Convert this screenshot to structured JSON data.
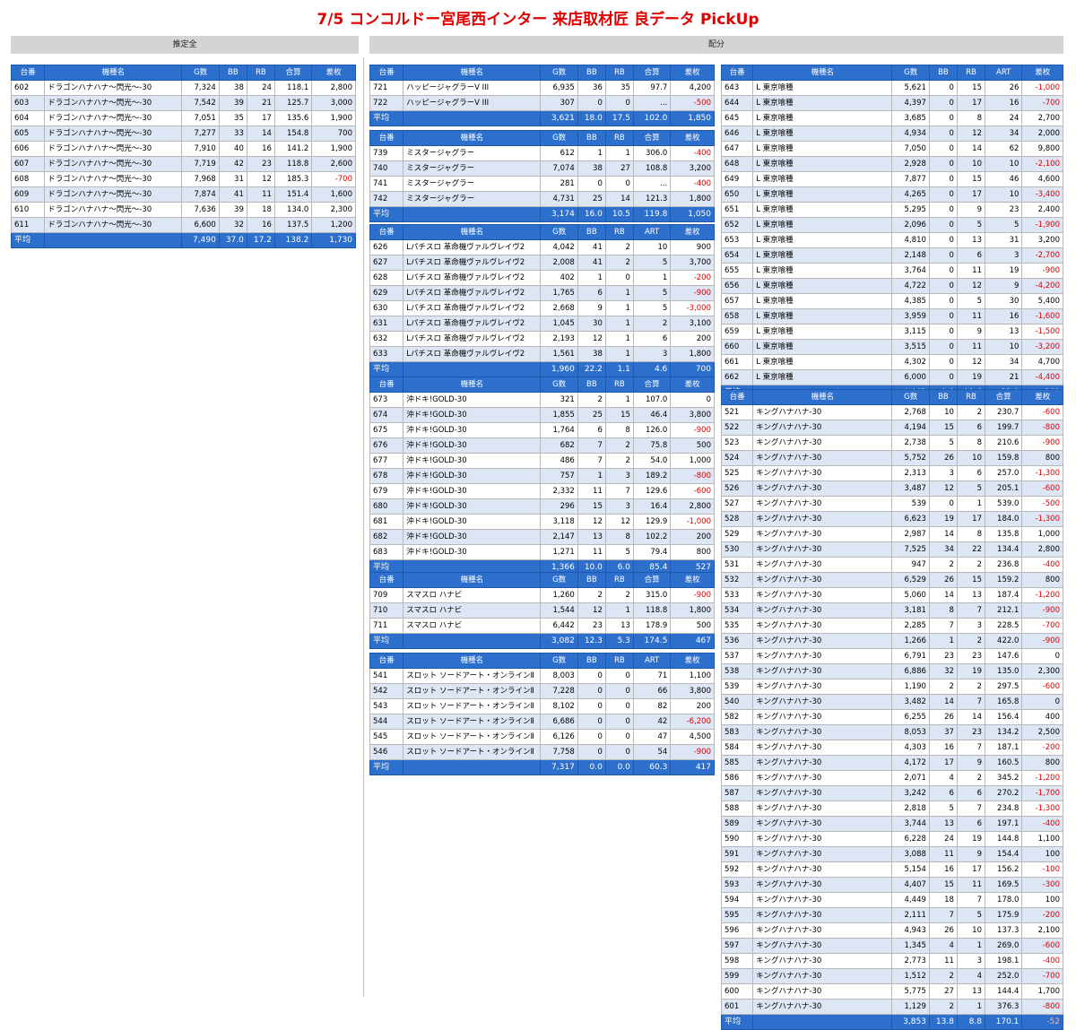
{
  "title": "7/5 コンコルドー宮尾西インター 来店取材匠 良データ PickUp",
  "sections": {
    "left": "推定全",
    "right": "配分"
  },
  "tables": [
    {
      "id": "dragon",
      "columns": [
        "台番",
        "機種名",
        "G数",
        "BB",
        "RB",
        "合算",
        "差枚"
      ],
      "rows": [
        [
          "602",
          "ドラゴンハナハナ〜閃光〜-30",
          "7,324",
          "38",
          "24",
          "118.1",
          "2,800"
        ],
        [
          "603",
          "ドラゴンハナハナ〜閃光〜-30",
          "7,542",
          "39",
          "21",
          "125.7",
          "3,000"
        ],
        [
          "604",
          "ドラゴンハナハナ〜閃光〜-30",
          "7,051",
          "35",
          "17",
          "135.6",
          "1,900"
        ],
        [
          "605",
          "ドラゴンハナハナ〜閃光〜-30",
          "7,277",
          "33",
          "14",
          "154.8",
          "700"
        ],
        [
          "606",
          "ドラゴンハナハナ〜閃光〜-30",
          "7,910",
          "40",
          "16",
          "141.2",
          "1,900"
        ],
        [
          "607",
          "ドラゴンハナハナ〜閃光〜-30",
          "7,719",
          "42",
          "23",
          "118.8",
          "2,600"
        ],
        [
          "608",
          "ドラゴンハナハナ〜閃光〜-30",
          "7,968",
          "31",
          "12",
          "185.3",
          "-700"
        ],
        [
          "609",
          "ドラゴンハナハナ〜閃光〜-30",
          "7,874",
          "41",
          "11",
          "151.4",
          "1,600"
        ],
        [
          "610",
          "ドラゴンハナハナ〜閃光〜-30",
          "7,636",
          "39",
          "18",
          "134.0",
          "2,300"
        ],
        [
          "611",
          "ドラゴンハナハナ〜閃光〜-30",
          "6,600",
          "32",
          "16",
          "137.5",
          "1,200"
        ]
      ],
      "avg": [
        "平均",
        "",
        "7,490",
        "37.0",
        "17.2",
        "138.2",
        "1,730"
      ]
    },
    {
      "id": "happy",
      "columns": [
        "台番",
        "機種名",
        "G数",
        "BB",
        "RB",
        "合算",
        "差枚"
      ],
      "rows": [
        [
          "721",
          "ハッピージャグラーV III",
          "6,935",
          "36",
          "35",
          "97.7",
          "4,200"
        ],
        [
          "722",
          "ハッピージャグラーV III",
          "307",
          "0",
          "0",
          "...",
          "-500"
        ]
      ],
      "avg": [
        "平均",
        "",
        "3,621",
        "18.0",
        "17.5",
        "102.0",
        "1,850"
      ]
    },
    {
      "id": "mister",
      "columns": [
        "台番",
        "機種名",
        "G数",
        "BB",
        "RB",
        "合算",
        "差枚"
      ],
      "rows": [
        [
          "739",
          "ミスタージャグラー",
          "612",
          "1",
          "1",
          "306.0",
          "-400"
        ],
        [
          "740",
          "ミスタージャグラー",
          "7,074",
          "38",
          "27",
          "108.8",
          "3,200"
        ],
        [
          "741",
          "ミスタージャグラー",
          "281",
          "0",
          "0",
          "...",
          "-400"
        ],
        [
          "742",
          "ミスタージャグラー",
          "4,731",
          "25",
          "14",
          "121.3",
          "1,800"
        ]
      ],
      "avg": [
        "平均",
        "",
        "3,174",
        "16.0",
        "10.5",
        "119.8",
        "1,050"
      ]
    },
    {
      "id": "valvrave",
      "columns": [
        "台番",
        "機種名",
        "G数",
        "BB",
        "RB",
        "ART",
        "差枚"
      ],
      "rows": [
        [
          "626",
          "Lパチスロ 革命機ヴァルヴレイヴ2",
          "4,042",
          "41",
          "2",
          "10",
          "900"
        ],
        [
          "627",
          "Lパチスロ 革命機ヴァルヴレイヴ2",
          "2,008",
          "41",
          "2",
          "5",
          "3,700"
        ],
        [
          "628",
          "Lパチスロ 革命機ヴァルヴレイヴ2",
          "402",
          "1",
          "0",
          "1",
          "-200"
        ],
        [
          "629",
          "Lパチスロ 革命機ヴァルヴレイヴ2",
          "1,765",
          "6",
          "1",
          "5",
          "-900"
        ],
        [
          "630",
          "Lパチスロ 革命機ヴァルヴレイヴ2",
          "2,668",
          "9",
          "1",
          "5",
          "-3,000"
        ],
        [
          "631",
          "Lパチスロ 革命機ヴァルヴレイヴ2",
          "1,045",
          "30",
          "1",
          "2",
          "3,100"
        ],
        [
          "632",
          "Lパチスロ 革命機ヴァルヴレイヴ2",
          "2,193",
          "12",
          "1",
          "6",
          "200"
        ],
        [
          "633",
          "Lパチスロ 革命機ヴァルヴレイヴ2",
          "1,561",
          "38",
          "1",
          "3",
          "1,800"
        ]
      ],
      "avg": [
        "平均",
        "",
        "1,960",
        "22.2",
        "1.1",
        "4.6",
        "700"
      ]
    },
    {
      "id": "okidoki",
      "columns": [
        "台番",
        "機種名",
        "G数",
        "BB",
        "RB",
        "合算",
        "差枚"
      ],
      "rows": [
        [
          "673",
          "沖ドキ!GOLD-30",
          "321",
          "2",
          "1",
          "107.0",
          "0"
        ],
        [
          "674",
          "沖ドキ!GOLD-30",
          "1,855",
          "25",
          "15",
          "46.4",
          "3,800"
        ],
        [
          "675",
          "沖ドキ!GOLD-30",
          "1,764",
          "6",
          "8",
          "126.0",
          "-900"
        ],
        [
          "676",
          "沖ドキ!GOLD-30",
          "682",
          "7",
          "2",
          "75.8",
          "500"
        ],
        [
          "677",
          "沖ドキ!GOLD-30",
          "486",
          "7",
          "2",
          "54.0",
          "1,000"
        ],
        [
          "678",
          "沖ドキ!GOLD-30",
          "757",
          "1",
          "3",
          "189.2",
          "-800"
        ],
        [
          "679",
          "沖ドキ!GOLD-30",
          "2,332",
          "11",
          "7",
          "129.6",
          "-600"
        ],
        [
          "680",
          "沖ドキ!GOLD-30",
          "296",
          "15",
          "3",
          "16.4",
          "2,800"
        ],
        [
          "681",
          "沖ドキ!GOLD-30",
          "3,118",
          "12",
          "12",
          "129.9",
          "-1,000"
        ],
        [
          "682",
          "沖ドキ!GOLD-30",
          "2,147",
          "13",
          "8",
          "102.2",
          "200"
        ],
        [
          "683",
          "沖ドキ!GOLD-30",
          "1,271",
          "11",
          "5",
          "79.4",
          "800"
        ]
      ],
      "avg": [
        "平均",
        "",
        "1,366",
        "10.0",
        "6.0",
        "85.4",
        "527"
      ]
    },
    {
      "id": "hanabi",
      "columns": [
        "台番",
        "機種名",
        "G数",
        "BB",
        "RB",
        "合算",
        "差枚"
      ],
      "rows": [
        [
          "709",
          "スマスロ ハナビ",
          "1,260",
          "2",
          "2",
          "315.0",
          "-900"
        ],
        [
          "710",
          "スマスロ ハナビ",
          "1,544",
          "12",
          "1",
          "118.8",
          "1,800"
        ],
        [
          "711",
          "スマスロ ハナビ",
          "6,442",
          "23",
          "13",
          "178.9",
          "500"
        ]
      ],
      "avg": [
        "平均",
        "",
        "3,082",
        "12.3",
        "5.3",
        "174.5",
        "467"
      ]
    },
    {
      "id": "sao",
      "columns": [
        "台番",
        "機種名",
        "G数",
        "BB",
        "RB",
        "ART",
        "差枚"
      ],
      "rows": [
        [
          "541",
          "スロット ソードアート・オンラインⅡ",
          "8,003",
          "0",
          "0",
          "71",
          "1,100"
        ],
        [
          "542",
          "スロット ソードアート・オンラインⅡ",
          "7,228",
          "0",
          "0",
          "66",
          "3,800"
        ],
        [
          "543",
          "スロット ソードアート・オンラインⅡ",
          "8,102",
          "0",
          "0",
          "82",
          "200"
        ],
        [
          "544",
          "スロット ソードアート・オンラインⅡ",
          "6,686",
          "0",
          "0",
          "42",
          "-6,200"
        ],
        [
          "545",
          "スロット ソードアート・オンラインⅡ",
          "6,126",
          "0",
          "0",
          "47",
          "4,500"
        ],
        [
          "546",
          "スロット ソードアート・オンラインⅡ",
          "7,758",
          "0",
          "0",
          "54",
          "-900"
        ]
      ],
      "avg": [
        "平均",
        "",
        "7,317",
        "0.0",
        "0.0",
        "60.3",
        "417"
      ]
    },
    {
      "id": "ghoul",
      "columns": [
        "台番",
        "機種名",
        "G数",
        "BB",
        "RB",
        "ART",
        "差枚"
      ],
      "rows": [
        [
          "643",
          "L 東京喰種",
          "5,621",
          "0",
          "15",
          "26",
          "-1,000"
        ],
        [
          "644",
          "L 東京喰種",
          "4,397",
          "0",
          "17",
          "16",
          "-700"
        ],
        [
          "645",
          "L 東京喰種",
          "3,685",
          "0",
          "8",
          "24",
          "2,700"
        ],
        [
          "646",
          "L 東京喰種",
          "4,934",
          "0",
          "12",
          "34",
          "2,000"
        ],
        [
          "647",
          "L 東京喰種",
          "7,050",
          "0",
          "14",
          "62",
          "9,800"
        ],
        [
          "648",
          "L 東京喰種",
          "2,928",
          "0",
          "10",
          "10",
          "-2,100"
        ],
        [
          "649",
          "L 東京喰種",
          "7,877",
          "0",
          "15",
          "46",
          "4,600"
        ],
        [
          "650",
          "L 東京喰種",
          "4,265",
          "0",
          "17",
          "10",
          "-3,400"
        ],
        [
          "651",
          "L 東京喰種",
          "5,295",
          "0",
          "9",
          "23",
          "2,400"
        ],
        [
          "652",
          "L 東京喰種",
          "2,096",
          "0",
          "5",
          "5",
          "-1,900"
        ],
        [
          "653",
          "L 東京喰種",
          "4,810",
          "0",
          "13",
          "31",
          "3,200"
        ],
        [
          "654",
          "L 東京喰種",
          "2,148",
          "0",
          "6",
          "3",
          "-2,700"
        ],
        [
          "655",
          "L 東京喰種",
          "3,764",
          "0",
          "11",
          "19",
          "-900"
        ],
        [
          "656",
          "L 東京喰種",
          "4,722",
          "0",
          "12",
          "9",
          "-4,200"
        ],
        [
          "657",
          "L 東京喰種",
          "4,385",
          "0",
          "5",
          "30",
          "5,400"
        ],
        [
          "658",
          "L 東京喰種",
          "3,959",
          "0",
          "11",
          "16",
          "-1,600"
        ],
        [
          "659",
          "L 東京喰種",
          "3,115",
          "0",
          "9",
          "13",
          "-1,500"
        ],
        [
          "660",
          "L 東京喰種",
          "3,515",
          "0",
          "11",
          "10",
          "-3,200"
        ],
        [
          "661",
          "L 東京喰種",
          "4,302",
          "0",
          "12",
          "34",
          "4,700"
        ],
        [
          "662",
          "L 東京喰種",
          "6,000",
          "0",
          "19",
          "21",
          "-4,400"
        ]
      ],
      "avg": [
        "平均",
        "",
        "4,443",
        "0.0",
        "11.6",
        "22.1",
        "360"
      ]
    },
    {
      "id": "king",
      "columns": [
        "台番",
        "機種名",
        "G数",
        "BB",
        "RB",
        "合算",
        "差枚"
      ],
      "rows": [
        [
          "521",
          "キングハナハナ-30",
          "2,768",
          "10",
          "2",
          "230.7",
          "-600"
        ],
        [
          "522",
          "キングハナハナ-30",
          "4,194",
          "15",
          "6",
          "199.7",
          "-800"
        ],
        [
          "523",
          "キングハナハナ-30",
          "2,738",
          "5",
          "8",
          "210.6",
          "-900"
        ],
        [
          "524",
          "キングハナハナ-30",
          "5,752",
          "26",
          "10",
          "159.8",
          "800"
        ],
        [
          "525",
          "キングハナハナ-30",
          "2,313",
          "3",
          "6",
          "257.0",
          "-1,300"
        ],
        [
          "526",
          "キングハナハナ-30",
          "3,487",
          "12",
          "5",
          "205.1",
          "-600"
        ],
        [
          "527",
          "キングハナハナ-30",
          "539",
          "0",
          "1",
          "539.0",
          "-500"
        ],
        [
          "528",
          "キングハナハナ-30",
          "6,623",
          "19",
          "17",
          "184.0",
          "-1,300"
        ],
        [
          "529",
          "キングハナハナ-30",
          "2,987",
          "14",
          "8",
          "135.8",
          "1,000"
        ],
        [
          "530",
          "キングハナハナ-30",
          "7,525",
          "34",
          "22",
          "134.4",
          "2,800"
        ],
        [
          "531",
          "キングハナハナ-30",
          "947",
          "2",
          "2",
          "236.8",
          "-400"
        ],
        [
          "532",
          "キングハナハナ-30",
          "6,529",
          "26",
          "15",
          "159.2",
          "800"
        ],
        [
          "533",
          "キングハナハナ-30",
          "5,060",
          "14",
          "13",
          "187.4",
          "-1,200"
        ],
        [
          "534",
          "キングハナハナ-30",
          "3,181",
          "8",
          "7",
          "212.1",
          "-900"
        ],
        [
          "535",
          "キングハナハナ-30",
          "2,285",
          "7",
          "3",
          "228.5",
          "-700"
        ],
        [
          "536",
          "キングハナハナ-30",
          "1,266",
          "1",
          "2",
          "422.0",
          "-900"
        ],
        [
          "537",
          "キングハナハナ-30",
          "6,791",
          "23",
          "23",
          "147.6",
          "0"
        ],
        [
          "538",
          "キングハナハナ-30",
          "6,886",
          "32",
          "19",
          "135.0",
          "2,300"
        ],
        [
          "539",
          "キングハナハナ-30",
          "1,190",
          "2",
          "2",
          "297.5",
          "-600"
        ],
        [
          "540",
          "キングハナハナ-30",
          "3,482",
          "14",
          "7",
          "165.8",
          "0"
        ],
        [
          "582",
          "キングハナハナ-30",
          "6,255",
          "26",
          "14",
          "156.4",
          "400"
        ],
        [
          "583",
          "キングハナハナ-30",
          "8,053",
          "37",
          "23",
          "134.2",
          "2,500"
        ],
        [
          "584",
          "キングハナハナ-30",
          "4,303",
          "16",
          "7",
          "187.1",
          "-200"
        ],
        [
          "585",
          "キングハナハナ-30",
          "4,172",
          "17",
          "9",
          "160.5",
          "800"
        ],
        [
          "586",
          "キングハナハナ-30",
          "2,071",
          "4",
          "2",
          "345.2",
          "-1,200"
        ],
        [
          "587",
          "キングハナハナ-30",
          "3,242",
          "6",
          "6",
          "270.2",
          "-1,700"
        ],
        [
          "588",
          "キングハナハナ-30",
          "2,818",
          "5",
          "7",
          "234.8",
          "-1,300"
        ],
        [
          "589",
          "キングハナハナ-30",
          "3,744",
          "13",
          "6",
          "197.1",
          "-400"
        ],
        [
          "590",
          "キングハナハナ-30",
          "6,228",
          "24",
          "19",
          "144.8",
          "1,100"
        ],
        [
          "591",
          "キングハナハナ-30",
          "3,088",
          "11",
          "9",
          "154.4",
          "100"
        ],
        [
          "592",
          "キングハナハナ-30",
          "5,154",
          "16",
          "17",
          "156.2",
          "-100"
        ],
        [
          "593",
          "キングハナハナ-30",
          "4,407",
          "15",
          "11",
          "169.5",
          "-300"
        ],
        [
          "594",
          "キングハナハナ-30",
          "4,449",
          "18",
          "7",
          "178.0",
          "100"
        ],
        [
          "595",
          "キングハナハナ-30",
          "2,111",
          "7",
          "5",
          "175.9",
          "-200"
        ],
        [
          "596",
          "キングハナハナ-30",
          "4,943",
          "26",
          "10",
          "137.3",
          "2,100"
        ],
        [
          "597",
          "キングハナハナ-30",
          "1,345",
          "4",
          "1",
          "269.0",
          "-600"
        ],
        [
          "598",
          "キングハナハナ-30",
          "2,773",
          "11",
          "3",
          "198.1",
          "-400"
        ],
        [
          "599",
          "キングハナハナ-30",
          "1,512",
          "2",
          "4",
          "252.0",
          "-700"
        ],
        [
          "600",
          "キングハナハナ-30",
          "5,775",
          "27",
          "13",
          "144.4",
          "1,700"
        ],
        [
          "601",
          "キングハナハナ-30",
          "1,129",
          "2",
          "1",
          "376.3",
          "-800"
        ]
      ],
      "avg": [
        "平均",
        "",
        "3,853",
        "13.8",
        "8.8",
        "170.1",
        "-52"
      ]
    }
  ]
}
